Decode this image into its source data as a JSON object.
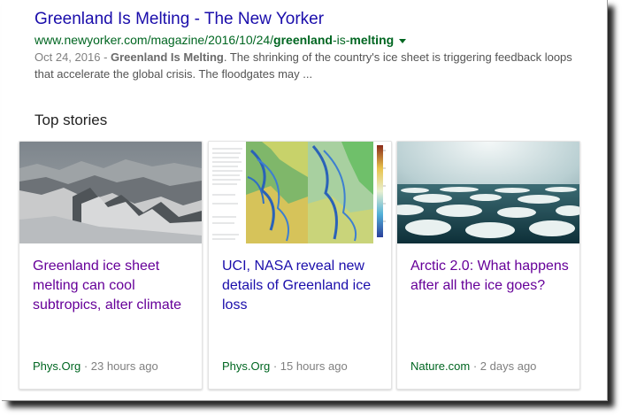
{
  "result": {
    "title": "Greenland Is Melting - The New Yorker",
    "url_prefix": "www.newyorker.com/magazine/2016/10/24/",
    "url_bold1": "greenland",
    "url_mid": "-is-",
    "url_bold2": "melting",
    "date": "Oct 24, 2016",
    "date_sep": " - ",
    "snippet_bold": "Greenland Is Melting",
    "snippet_rest": ". The shrinking of the country's ice sheet is triggering feedback loops that accelerate the global crisis. The floodgates may ..."
  },
  "top_stories": {
    "heading": "Top stories",
    "cards": [
      {
        "title": "Greenland ice sheet melting can cool subtropics, alter climate",
        "source": "Phys.Org",
        "separator": "·",
        "time": "23 hours ago",
        "visited": true
      },
      {
        "title": "UCI, NASA reveal new details of Greenland ice loss",
        "source": "Phys.Org",
        "separator": "·",
        "time": "15 hours ago",
        "visited": false
      },
      {
        "title": "Arctic 2.0: What happens after all the ice goes?",
        "source": "Nature.com",
        "separator": "·",
        "time": "2 days ago",
        "visited": true
      }
    ]
  },
  "colors": {
    "link": "#1a0dab",
    "visited": "#660099",
    "url_green": "#006621",
    "snippet": "#545454"
  }
}
